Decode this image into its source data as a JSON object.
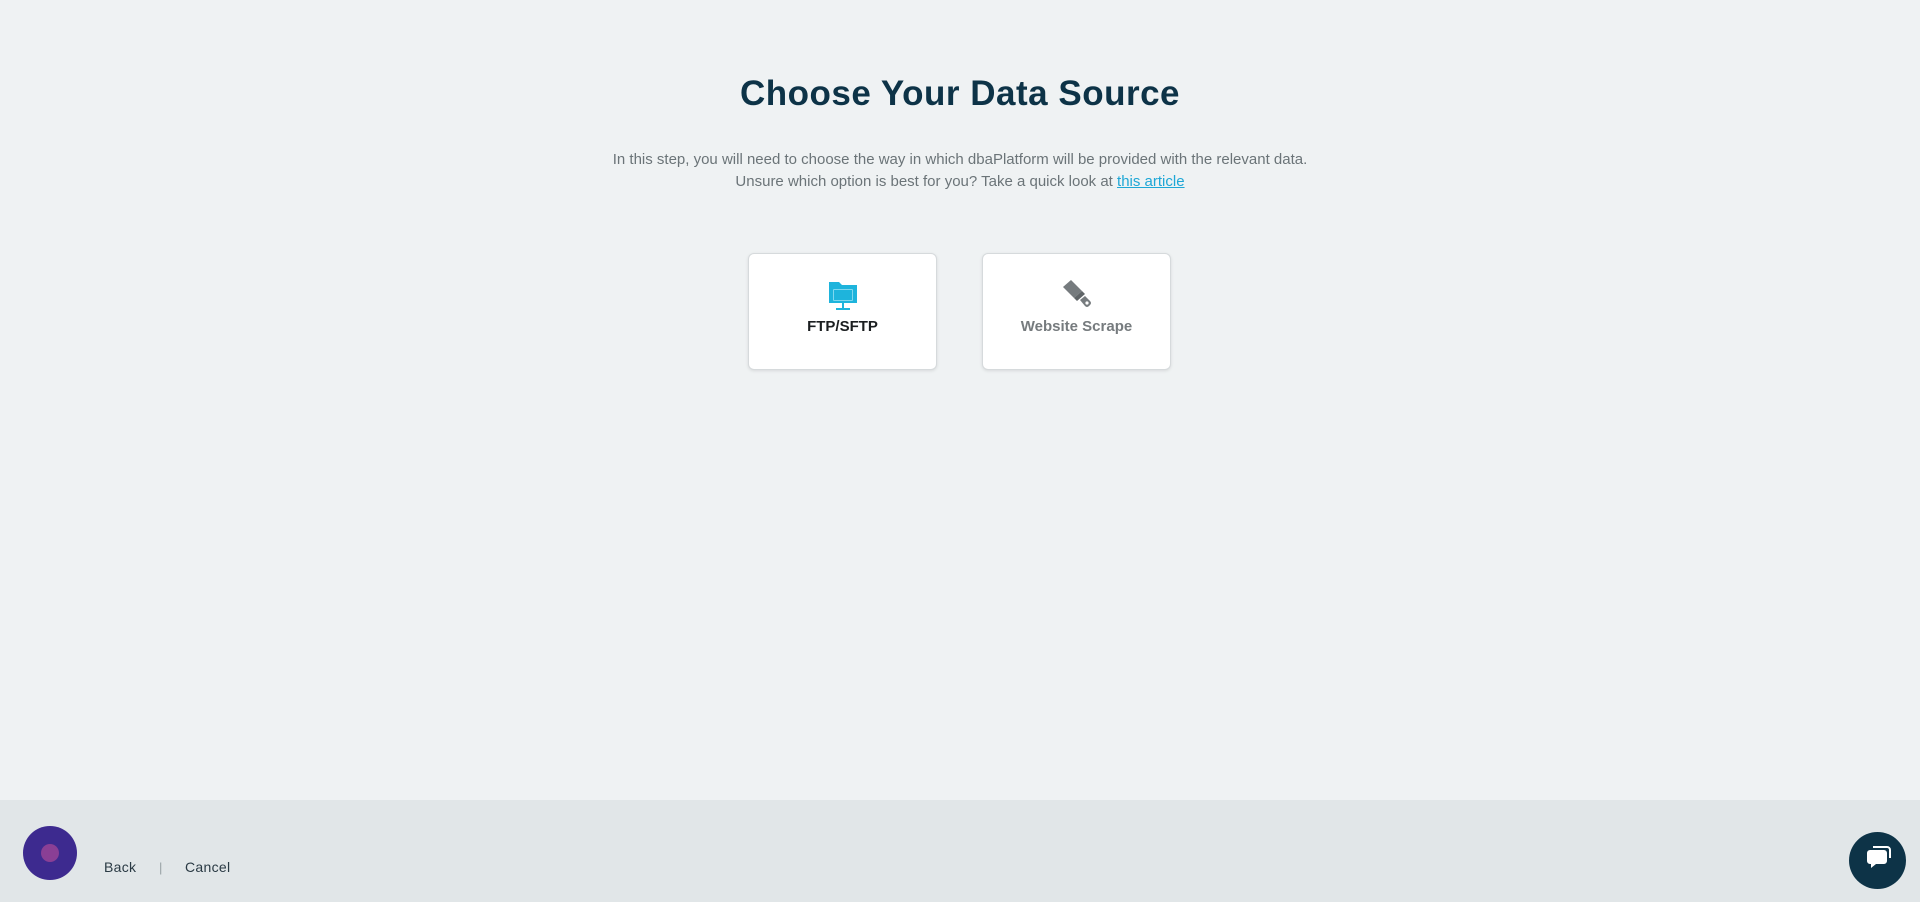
{
  "page": {
    "title": "Choose Your Data Source",
    "description_line1": "In this step, you will need to choose the way in which dbaPlatform will be provided with the relevant data.",
    "description_line2_prefix": "Unsure which option is best for you? Take a quick look at ",
    "article_link": "this article"
  },
  "options": [
    {
      "label": "FTP/SFTP",
      "icon": "folder-network-icon",
      "color": "#1eb4dc",
      "selected": true
    },
    {
      "label": "Website Scrape",
      "icon": "scraper-icon",
      "color": "#767b7e",
      "selected": false
    }
  ],
  "footer": {
    "back_label": "Back",
    "separator": "|",
    "cancel_label": "Cancel"
  },
  "colors": {
    "background": "#eff2f3",
    "footer_background": "#e1e6e8",
    "title": "#0d3347",
    "accent": "#1eb4dc",
    "avatar": "#3d2a8f",
    "chat_button": "#0d3347"
  }
}
